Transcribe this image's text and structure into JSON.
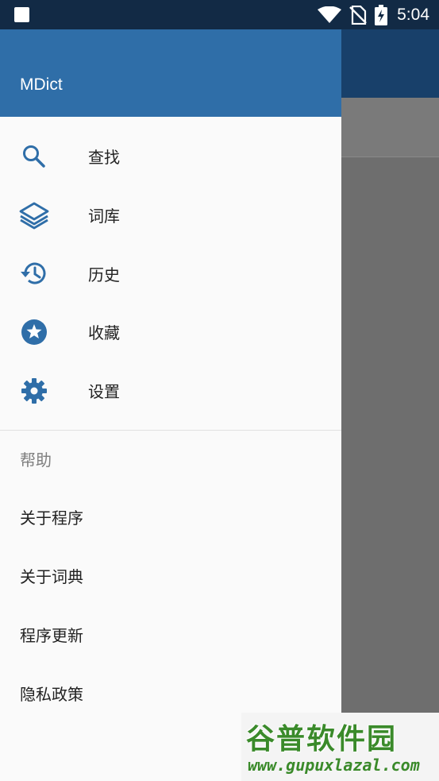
{
  "status_bar": {
    "time": "5:04",
    "icons": [
      "notification-square-icon",
      "wifi-icon",
      "no-sim-icon",
      "battery-charging-icon"
    ]
  },
  "drawer": {
    "title": "MDict",
    "header_color": "#2f6ea8",
    "nav_items": [
      {
        "label": "查找",
        "icon": "search-icon"
      },
      {
        "label": "词库",
        "icon": "layers-icon"
      },
      {
        "label": "历史",
        "icon": "history-icon"
      },
      {
        "label": "收藏",
        "icon": "star-icon"
      },
      {
        "label": "设置",
        "icon": "gear-icon"
      }
    ],
    "help_section": {
      "header": "帮助",
      "items": [
        "关于程序",
        "关于词典",
        "程序更新",
        "隐私政策"
      ]
    }
  },
  "watermark": {
    "brand": "谷普软件园",
    "url": "www.gupuxlazal.com"
  }
}
